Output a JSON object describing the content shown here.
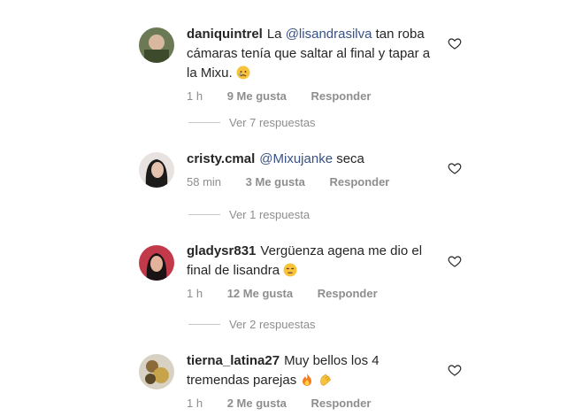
{
  "comments": [
    {
      "username": "daniquintrel",
      "mention": "@lisandrasilva",
      "text_before": "La",
      "text_after": "tan roba cámaras tenía que saltar al final y tapar a la Mixu.",
      "time": "1 h",
      "likes": "9 Me gusta",
      "reply": "Responder",
      "view_replies": "Ver 7 respuestas"
    },
    {
      "username": "cristy.cmal",
      "mention": "@Mixujanke",
      "text_before": "",
      "text_after": "seca",
      "time": "58 min",
      "likes": "3 Me gusta",
      "reply": "Responder",
      "view_replies": "Ver 1 respuesta"
    },
    {
      "username": "gladysr831",
      "mention": "",
      "text_before": "",
      "text_after": "Vergüenza agena me dio el final de lisandra",
      "time": "1 h",
      "likes": "12 Me gusta",
      "reply": "Responder",
      "view_replies": "Ver 2 respuestas"
    },
    {
      "username": "tierna_latina27",
      "mention": "",
      "text_before": "",
      "text_after": "Muy bellos los 4 tremendas parejas",
      "time": "1 h",
      "likes": "2 Me gusta",
      "reply": "Responder"
    }
  ],
  "icons": [
    "heart-outline-icon",
    "crying-face-emoji",
    "unamused-face-emoji",
    "fire-emoji",
    "clapping-hands-emoji"
  ]
}
